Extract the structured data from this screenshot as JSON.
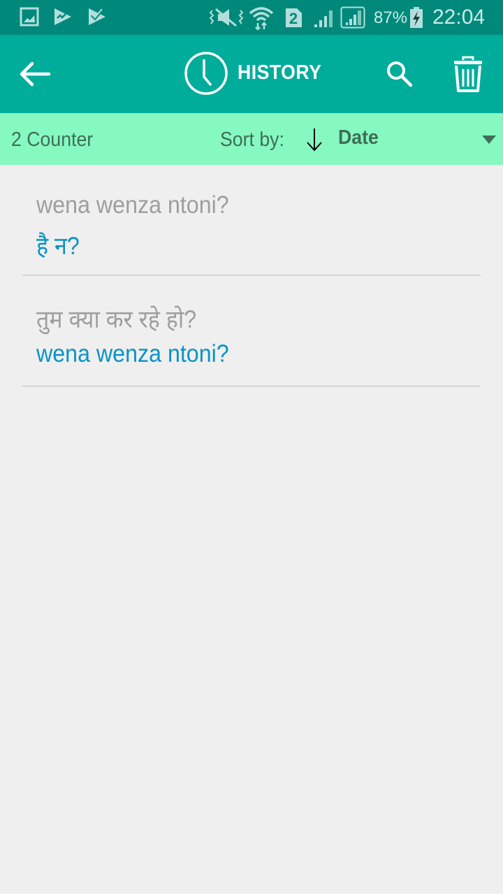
{
  "status_bar": {
    "icons": [
      "gallery-icon",
      "play-store-icon",
      "check-task-icon",
      "mute-vibrate-icon",
      "wifi-icon",
      "sim2-icon",
      "signal-icon",
      "signal-sim2-icon",
      "battery-charging-icon"
    ],
    "sim_label": "2",
    "battery": "87%",
    "time": "22:04"
  },
  "toolbar": {
    "title": "HISTORY",
    "back_icon": "back-arrow-icon",
    "title_icon": "clock-icon",
    "search_icon": "search-icon",
    "delete_icon": "trash-icon"
  },
  "subbar": {
    "counter": "2 Counter",
    "sort_label": "Sort by:",
    "sort_direction": "descending",
    "sort_value": "Date"
  },
  "history": [
    {
      "source": "wena wenza ntoni?",
      "translation": "है न?"
    },
    {
      "source": "तुम क्या कर रहे हो?",
      "translation": "wena wenza ntoni?"
    }
  ],
  "colors": {
    "statusbar": "#00897b",
    "toolbar": "#00ad9b",
    "subbar": "#86f9c0",
    "source_text": "#9e9e9e",
    "translation_text": "#0a93c5"
  }
}
